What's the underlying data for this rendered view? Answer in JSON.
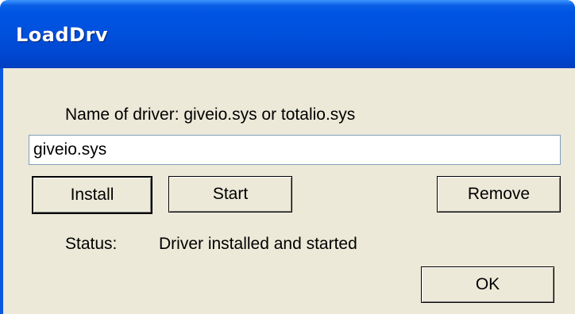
{
  "window": {
    "title": "LoadDrv"
  },
  "driver": {
    "label": "Name of driver: giveio.sys or totalio.sys",
    "value": "giveio.sys"
  },
  "buttons": {
    "install": "Install",
    "start": "Start",
    "remove": "Remove",
    "ok": "OK"
  },
  "status": {
    "label": "Status:",
    "value": "Driver installed and started"
  },
  "colors": {
    "titlebar": "#0054e3",
    "window_background": "#ece9d8",
    "textbox_border": "#7f9db9"
  }
}
